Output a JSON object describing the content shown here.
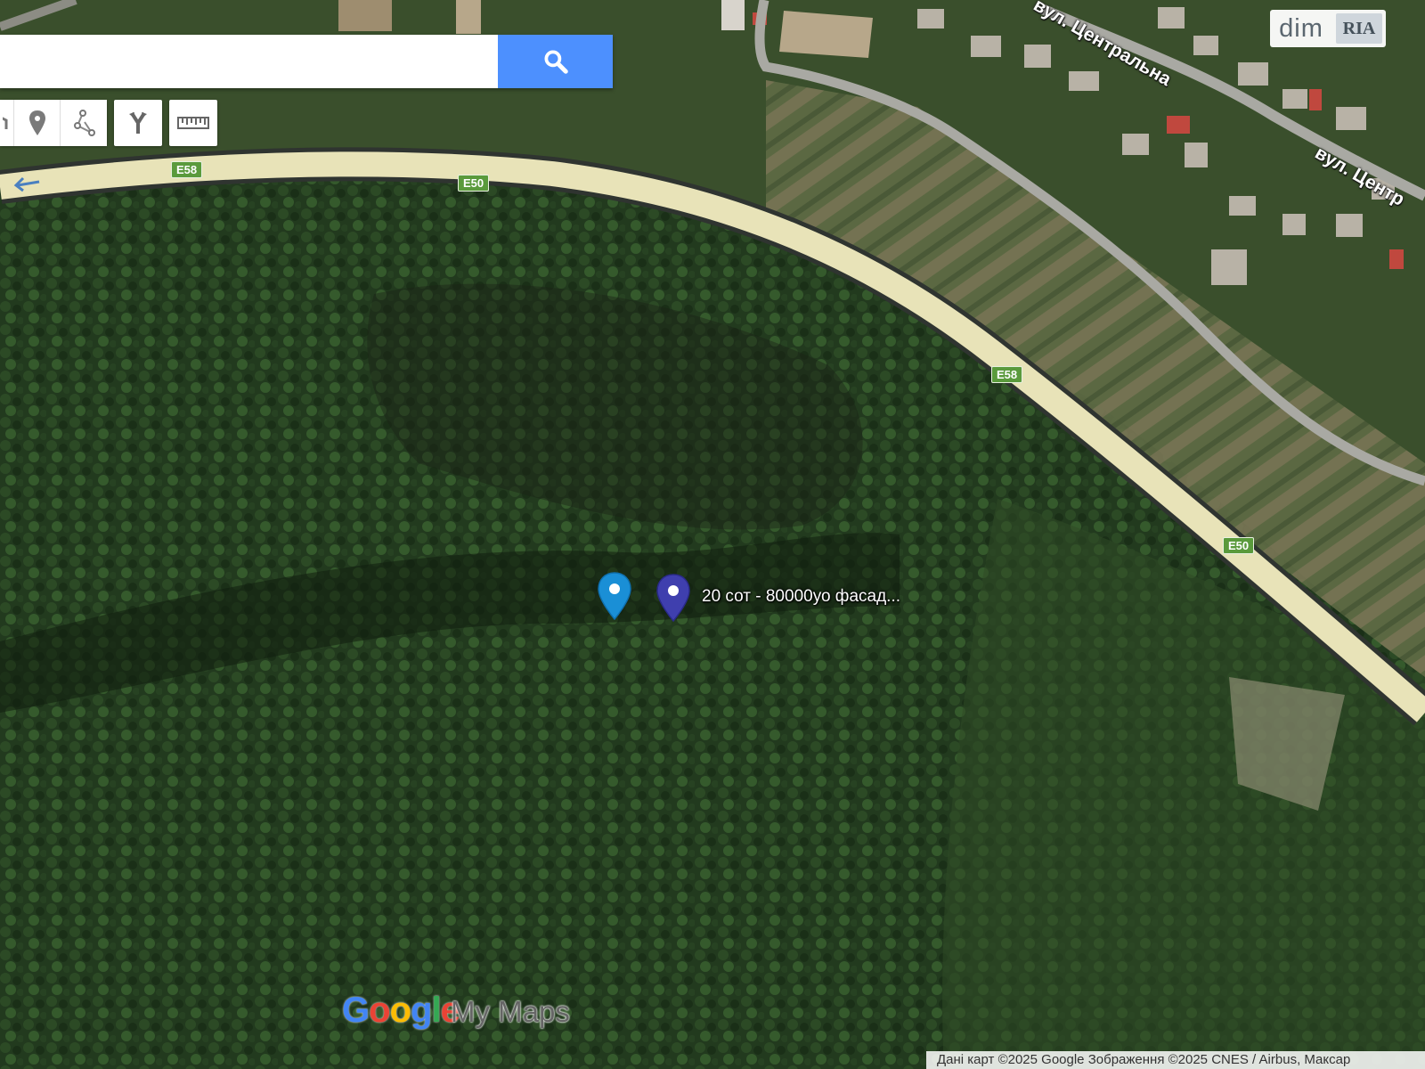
{
  "search": {
    "placeholder": "",
    "value": ""
  },
  "toolbar": {
    "tools": [
      "hand-icon",
      "marker-icon",
      "polyline-icon",
      "directions-icon",
      "ruler-icon"
    ]
  },
  "brand": {
    "dim": "dim",
    "ria": "RIA"
  },
  "streets": [
    "вул. Центральна",
    "вул. Центр"
  ],
  "roads": [
    "E58",
    "E50",
    "E50",
    "E58",
    "E50"
  ],
  "markers": [
    {
      "label": "",
      "color": "#1a8fd6"
    },
    {
      "label": "20 сот - 80000уо фасад...",
      "color": "#3f3fae"
    }
  ],
  "google_logo": {
    "text": "Google",
    "suffix": "My Maps"
  },
  "attribution": "Дані карт ©2025 Google Зображення ©2025 CNES / Airbus, Максар",
  "colors": {
    "search_button": "#4d90fe",
    "road_shield": "#5a9a3c",
    "forest": "#1d3319"
  }
}
